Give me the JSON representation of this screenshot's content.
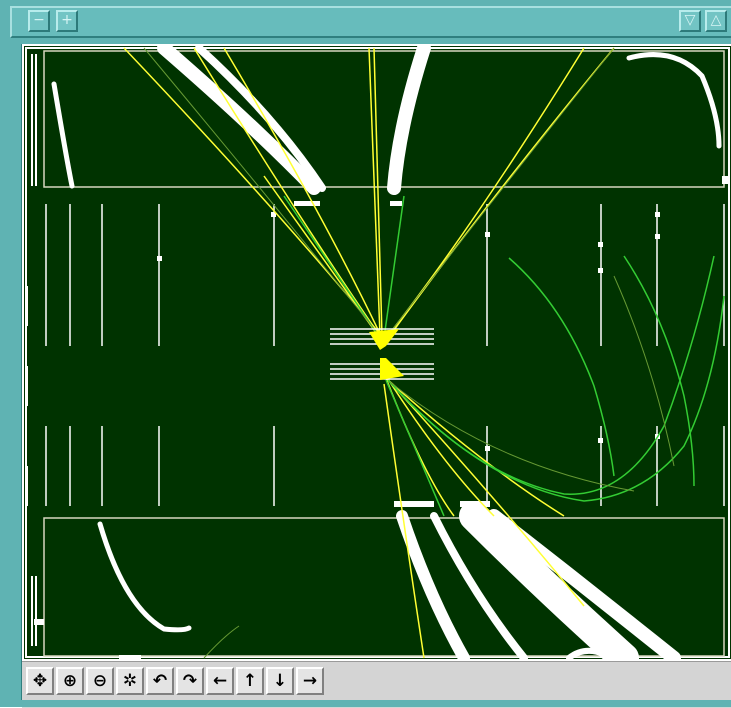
{
  "window": {
    "title": "",
    "controls": {
      "minimize_glyph": "−",
      "maximize_glyph": "+",
      "shade_down_glyph": "▽",
      "shade_up_glyph": "△"
    }
  },
  "viewer": {
    "background_color": "#003300",
    "frame_color": "#ffffff",
    "colors": {
      "tracks_primary": "#ffff33",
      "tracks_secondary": "#33cc33",
      "tracks_faint": "#669933",
      "hits": "#ffffff"
    }
  },
  "toolbar": {
    "tools": [
      {
        "name": "pan",
        "glyph": "✥"
      },
      {
        "name": "zoom-in",
        "glyph": "⊕"
      },
      {
        "name": "zoom-out",
        "glyph": "⊖"
      },
      {
        "name": "reset-view",
        "glyph": "✲"
      },
      {
        "name": "rotate-left",
        "glyph": "↶"
      },
      {
        "name": "rotate-right",
        "glyph": "↷"
      },
      {
        "name": "move-left",
        "glyph": "←"
      },
      {
        "name": "move-up",
        "glyph": "↑"
      },
      {
        "name": "move-down",
        "glyph": "↓"
      },
      {
        "name": "move-right",
        "glyph": "→"
      }
    ]
  }
}
